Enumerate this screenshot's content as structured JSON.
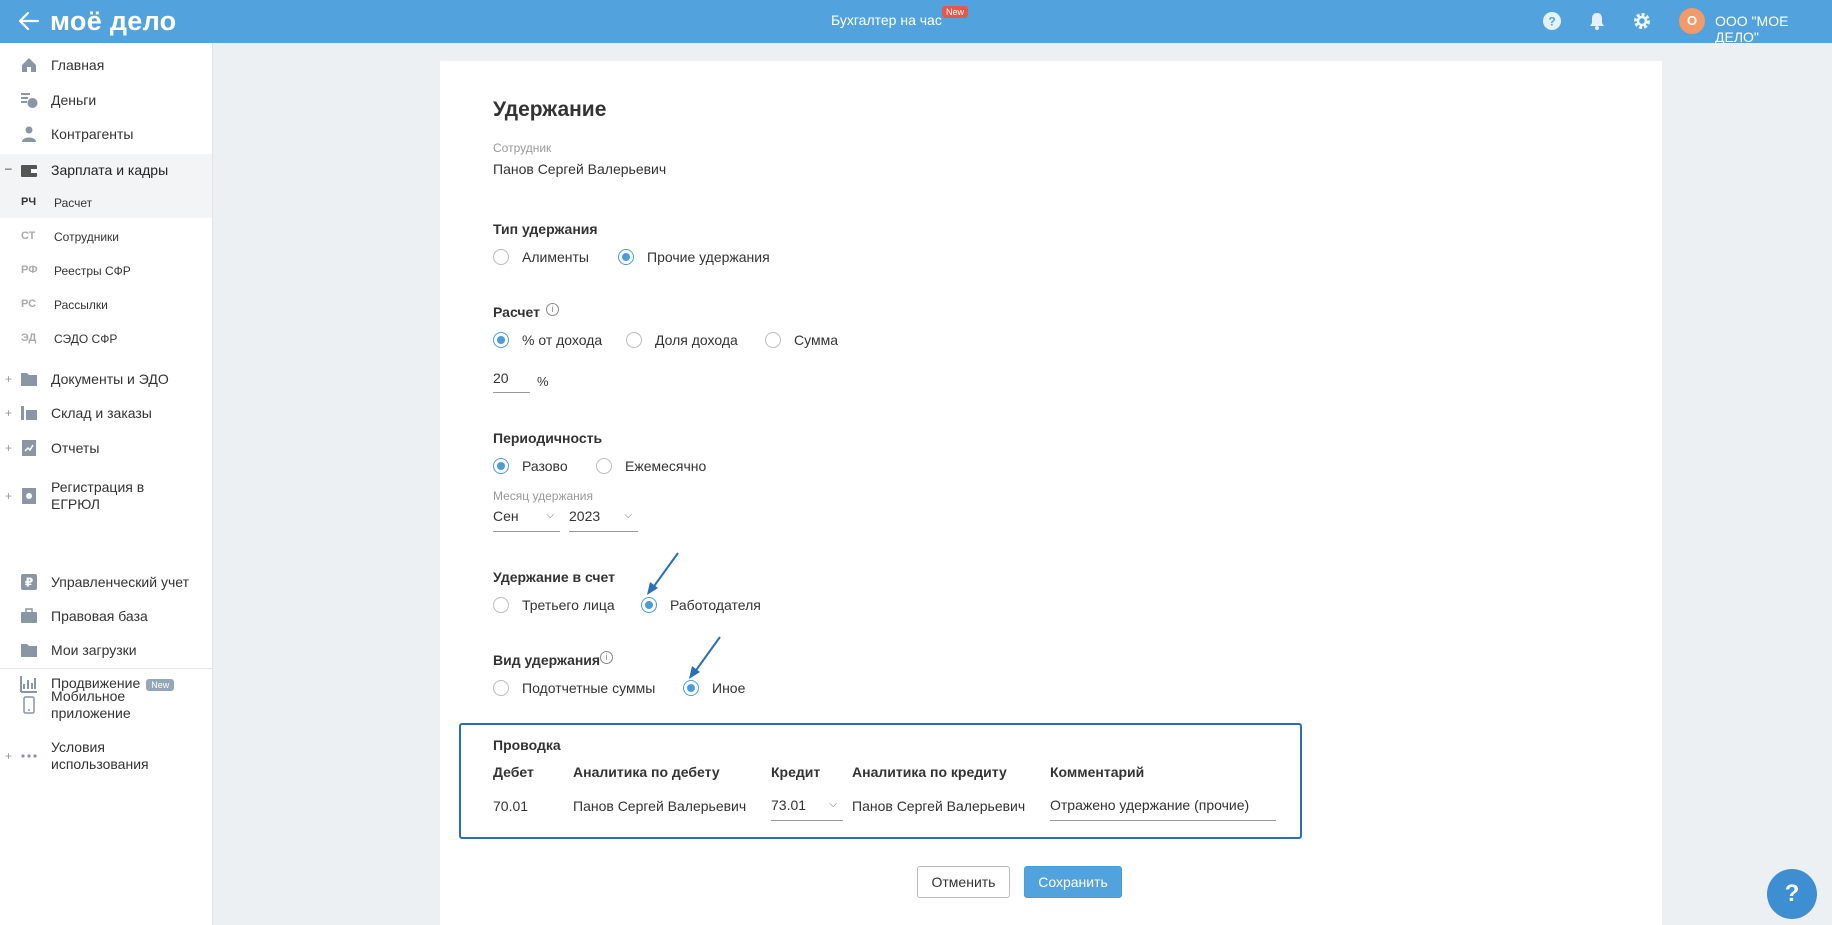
{
  "header": {
    "logo": "моё дело",
    "center_title": "Бухгалтер на час",
    "new_badge": "New",
    "avatar_initial": "О",
    "org_name": "ООО \"МОЕ ДЕЛО\""
  },
  "sidebar": {
    "items": [
      {
        "label": "Главная"
      },
      {
        "label": "Деньги"
      },
      {
        "label": "Контрагенты"
      },
      {
        "label": "Зарплата и кадры"
      },
      {
        "label": "Документы и ЭДО"
      },
      {
        "label": "Склад и заказы"
      },
      {
        "label": "Отчеты"
      },
      {
        "label": "Регистрация в ЕГРЮЛ"
      },
      {
        "label": "Управленческий учет"
      },
      {
        "label": "Правовая база"
      },
      {
        "label": "Мои загрузки"
      },
      {
        "label": "Продвижение",
        "badge": "New"
      },
      {
        "label": "Мобильное приложение"
      },
      {
        "label": "Условия использования"
      }
    ],
    "subitems": [
      {
        "abbr": "РЧ",
        "label": "Расчет"
      },
      {
        "abbr": "СТ",
        "label": "Сотрудники"
      },
      {
        "abbr": "РФ",
        "label": "Реестры СФР"
      },
      {
        "abbr": "РС",
        "label": "Рассылки"
      },
      {
        "abbr": "ЭД",
        "label": "СЭДО СФР"
      }
    ],
    "collapse_sign": "–",
    "expand_sign": "+"
  },
  "form": {
    "title": "Удержание",
    "employee_label": "Сотрудник",
    "employee_value": "Панов Сергей Валерьевич",
    "type": {
      "title": "Тип удержания",
      "options": [
        "Алименты",
        "Прочие удержания"
      ],
      "selected": "Прочие удержания"
    },
    "calc": {
      "title": "Расчет",
      "options": [
        "% от дохода",
        "Доля дохода",
        "Сумма"
      ],
      "selected": "% от дохода",
      "percent_value": "20",
      "unit": "%"
    },
    "period": {
      "title": "Периодичность",
      "options": [
        "Разово",
        "Ежемесячно"
      ],
      "selected": "Разово",
      "month_label": "Месяц удержания",
      "month": "Сен",
      "year": "2023"
    },
    "account": {
      "title": "Удержание в счет",
      "options": [
        "Третьего лица",
        "Работодателя"
      ],
      "selected": "Работодателя"
    },
    "kind": {
      "title": "Вид удержания",
      "options": [
        "Подотчетные суммы",
        "Иное"
      ],
      "selected": "Иное"
    },
    "posting": {
      "title": "Проводка",
      "headers": [
        "Дебет",
        "Аналитика по дебету",
        "Кредит",
        "Аналитика по кредиту",
        "Комментарий"
      ],
      "row": {
        "debit": "70.01",
        "debit_analytics": "Панов Сергей Валерьевич",
        "credit": "73.01",
        "credit_analytics": "Панов Сергей Валерьевич",
        "comment": "Отражено удержание (прочие)"
      }
    },
    "cancel_label": "Отменить",
    "save_label": "Сохранить"
  },
  "help_button": "?",
  "colors": {
    "topbar": "#52a3dd",
    "accent": "#4b9cd8",
    "highlight_border": "#2a6fb8",
    "new_badge": "#e8574c"
  }
}
